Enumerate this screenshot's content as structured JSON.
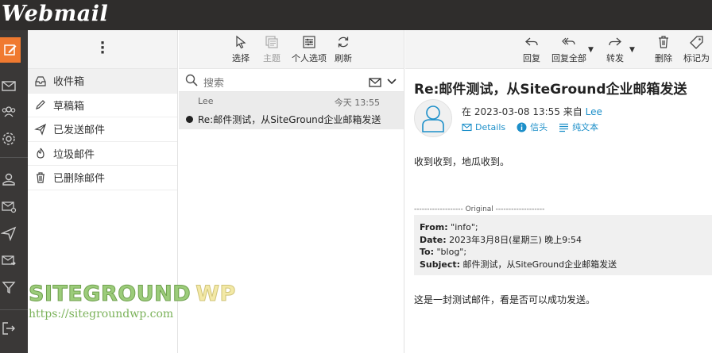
{
  "app": {
    "logo": "Webmail"
  },
  "rail": {
    "items": [
      "compose-icon",
      "mail-icon",
      "contacts-icon",
      "settings-icon",
      "user-icon",
      "mail-settings-icon",
      "send-icon",
      "forward-icon",
      "filter-icon",
      "logout-icon"
    ],
    "accent": "#f07a30"
  },
  "folders": {
    "menu_icon": "more-vertical-icon",
    "items": [
      {
        "label": "收件箱",
        "icon": "inbox-icon"
      },
      {
        "label": "草稿箱",
        "icon": "pencil-icon"
      },
      {
        "label": "已发送邮件",
        "icon": "send-icon"
      },
      {
        "label": "垃圾邮件",
        "icon": "fire-icon"
      },
      {
        "label": "已删除邮件",
        "icon": "trash-icon"
      }
    ]
  },
  "list_toolbar": {
    "select": "选择",
    "thread": "主题",
    "options": "个人选项",
    "refresh": "刷新"
  },
  "search": {
    "placeholder": "搜索"
  },
  "messages": [
    {
      "sender": "Lee",
      "time": "今天 13:55",
      "subject": "Re:邮件测试，从SiteGround企业邮箱发送"
    }
  ],
  "reader_toolbar": {
    "reply": "回复",
    "reply_all": "回复全部",
    "forward": "转发",
    "delete": "删除",
    "mark": "标记为"
  },
  "message": {
    "subject": "Re:邮件测试，从SiteGround企业邮箱发送",
    "date_prefix": "在 2023-03-08 13:55 来自",
    "from_name": "Lee",
    "details": "Details",
    "headers": "信头",
    "plain_text": "纯文本",
    "body_reply": "收到收到，地瓜收到。",
    "original_label": "------------------- Original -------------------",
    "quote": {
      "from_label": "From:",
      "from_value": "\"info\";",
      "date_label": "Date:",
      "date_value": "2023年3月8日(星期三) 晚上9:54",
      "to_label": "To:",
      "to_value": "\"blog\";",
      "subject_label": "Subject:",
      "subject_value": "邮件测试，从SiteGround企业邮箱发送"
    },
    "body_original": "这是一封测试邮件，看是否可以成功发送。"
  },
  "watermark": {
    "part1": "SITEGROUND",
    "part2": "WP",
    "url": "https://sitegroundwp.com"
  }
}
